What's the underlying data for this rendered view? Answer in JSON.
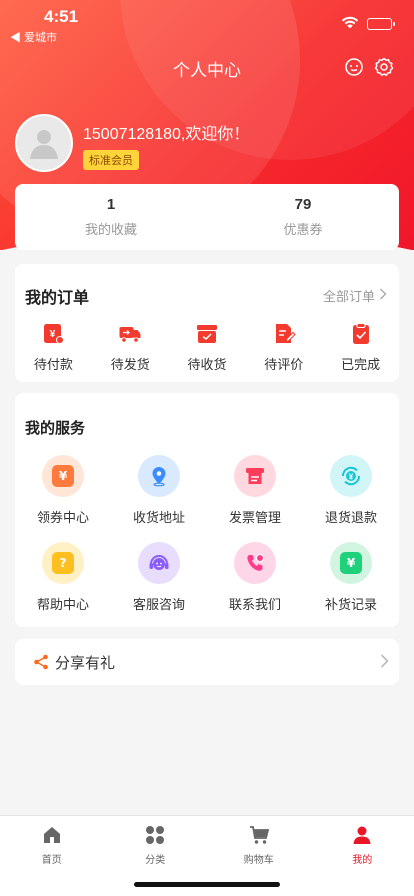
{
  "status_bar": {
    "time": "4:51",
    "back_app": "◀ 爱城市"
  },
  "nav": {
    "title": "个人中心"
  },
  "profile": {
    "welcome": "15007128180,欢迎你！",
    "level": "标准会员"
  },
  "stats": [
    {
      "value": "1",
      "label": "我的收藏"
    },
    {
      "value": "79",
      "label": "优惠券"
    }
  ],
  "orders": {
    "title": "我的订单",
    "all_label": "全部订单",
    "items": [
      {
        "label": "待付款",
        "icon": "pending-payment-icon"
      },
      {
        "label": "待发货",
        "icon": "truck-icon"
      },
      {
        "label": "待收货",
        "icon": "package-icon"
      },
      {
        "label": "待评价",
        "icon": "review-icon"
      },
      {
        "label": "已完成",
        "icon": "completed-icon"
      }
    ]
  },
  "services": {
    "title": "我的服务",
    "items": [
      {
        "label": "领券中心",
        "icon": "coupon-icon",
        "color": "#ff7a3d",
        "bg": "#ffe6d6",
        "glyph": "¥"
      },
      {
        "label": "收货地址",
        "icon": "location-icon",
        "color": "#3b8cff",
        "bg": "#d9e9ff",
        "glyph": ""
      },
      {
        "label": "发票管理",
        "icon": "invoice-icon",
        "color": "#ff3d5a",
        "bg": "#ffd9df",
        "glyph": ""
      },
      {
        "label": "退货退款",
        "icon": "refund-icon",
        "color": "#19c6d6",
        "bg": "#d2f6f8",
        "glyph": "¥"
      },
      {
        "label": "帮助中心",
        "icon": "help-icon",
        "color": "#ffbf1f",
        "bg": "#fff0c6",
        "glyph": "?"
      },
      {
        "label": "客服咨询",
        "icon": "customer-service-icon",
        "color": "#8a5cff",
        "bg": "#e8dcff",
        "glyph": ""
      },
      {
        "label": "联系我们",
        "icon": "phone-icon",
        "color": "#ff3d8a",
        "bg": "#ffd6e7",
        "glyph": ""
      },
      {
        "label": "补货记录",
        "icon": "restock-icon",
        "color": "#1fd17a",
        "bg": "#d2f5e2",
        "glyph": "¥"
      }
    ]
  },
  "share": {
    "label": "分享有礼"
  },
  "tabbar": [
    {
      "label": "首页",
      "icon": "home-icon",
      "active": false
    },
    {
      "label": "分类",
      "icon": "category-icon",
      "active": false
    },
    {
      "label": "购物车",
      "icon": "cart-icon",
      "active": false
    },
    {
      "label": "我的",
      "icon": "user-icon",
      "active": true
    }
  ],
  "colors": {
    "brand": "#f72b2b",
    "active_tab": "#e91628",
    "order_icon": "#f23a2f"
  }
}
